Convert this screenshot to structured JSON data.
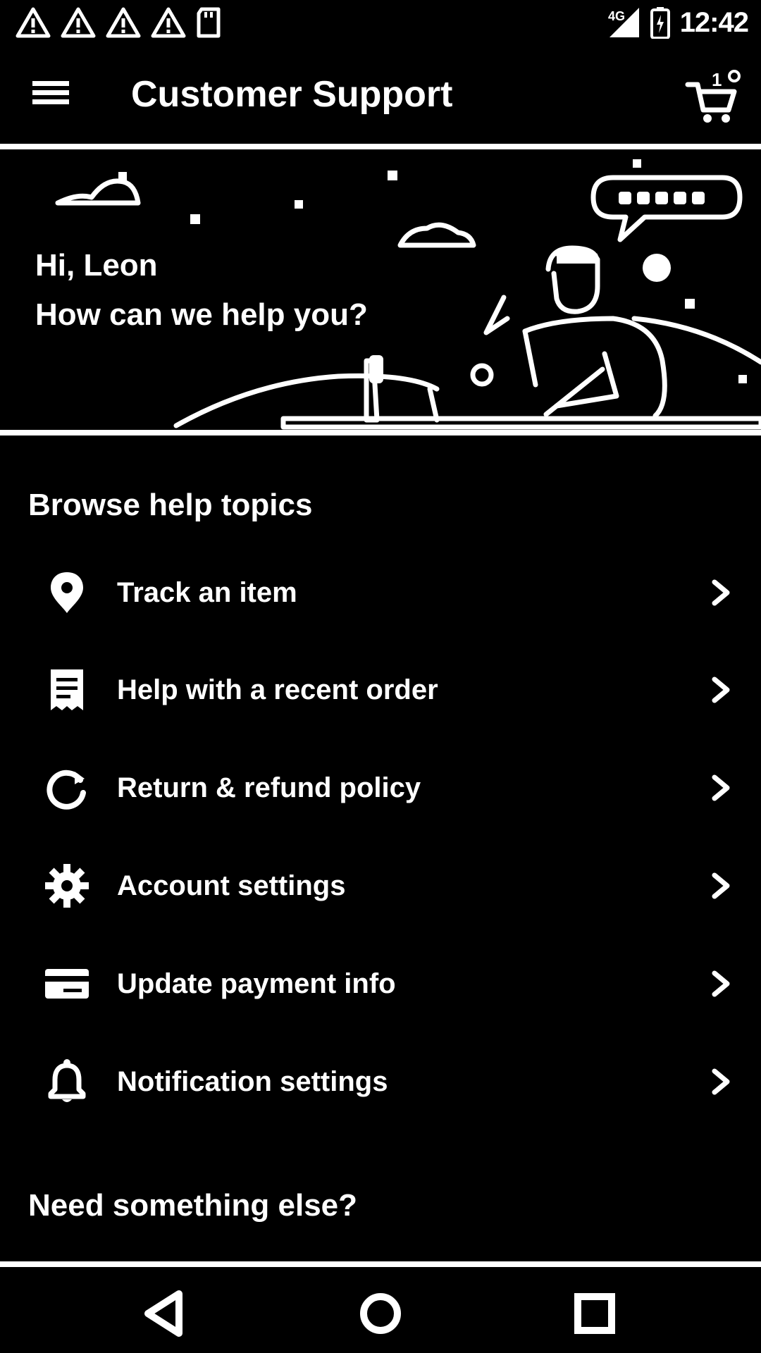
{
  "status_bar": {
    "notification_icons": [
      "warning-icon",
      "warning-icon",
      "warning-icon",
      "warning-icon",
      "sd-card-icon"
    ],
    "signal_icon": "signal-icon",
    "battery_icon": "battery-icon",
    "time": "12:42"
  },
  "app_bar": {
    "menu_icon": "hamburger-menu-icon",
    "title": "Customer Support",
    "cart_icon": "cart-icon"
  },
  "hero": {
    "greeting": "Hi, Leon",
    "question": "How can we help you?"
  },
  "help_topics": {
    "section_title": "Browse help topics",
    "items": [
      {
        "label": "Track an item",
        "icon": "location-pin-icon"
      },
      {
        "label": "Help with a recent order",
        "icon": "receipt-icon"
      },
      {
        "label": "Return & refund policy",
        "icon": "refresh-icon"
      },
      {
        "label": "Account settings",
        "icon": "gear-icon"
      },
      {
        "label": "Update payment info",
        "icon": "credit-card-icon"
      },
      {
        "label": "Notification settings",
        "icon": "bell-icon"
      }
    ]
  },
  "more_section": {
    "title": "Need something else?"
  },
  "nav_bar": {
    "back_icon": "back-triangle-icon",
    "home_icon": "home-circle-icon",
    "recents_icon": "recents-square-icon"
  },
  "colors": {
    "background": "#000000",
    "foreground": "#ffffff"
  }
}
